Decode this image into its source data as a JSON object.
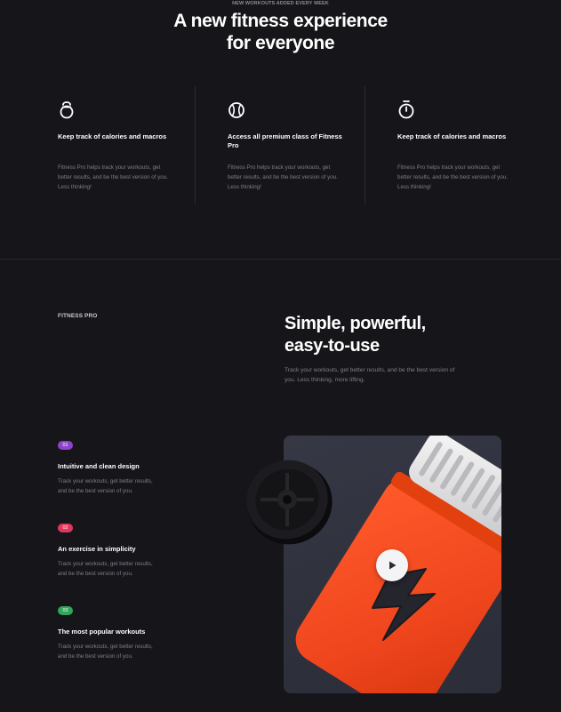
{
  "hero": {
    "eyebrow": "NEW WORKOUTS ADDED EVERY WEEK",
    "title_line1": "A new fitness experience",
    "title_line2": "for everyone"
  },
  "features": [
    {
      "icon": "kettlebell-icon",
      "title": "Keep track of calories and macros",
      "description": "Fitness Pro helps track your workouts, get better results, and be the best version of you. Less thinking!"
    },
    {
      "icon": "ball-icon",
      "title": "Access all premium class of Fitness Pro",
      "description": "Fitness Pro helps track your workouts, get better results, and be the best version of you. Less thinking!"
    },
    {
      "icon": "stopwatch-icon",
      "title": "Keep track of calories and macros",
      "description": "Fitness Pro helps track your workouts, get better results, and be the best version of you. Less thinking!"
    }
  ],
  "section": {
    "brand_label": "FITNESS PRO",
    "title_line1": "Simple, powerful,",
    "title_line2": "easy-to-use",
    "description": "Track your workouts, get better results, and be the best version of you. Less thinking, more lifting."
  },
  "items": [
    {
      "badge": "01",
      "badge_color": "#8e44c9",
      "title": "Intuitive and clean design",
      "description": "Track your workouts, get better results, and be the best version of you."
    },
    {
      "badge": "02",
      "badge_color": "#e0375a",
      "title": "An exercise in simplicity",
      "description": "Track your workouts, get better results, and be the best version of you."
    },
    {
      "badge": "03",
      "badge_color": "#2fa65a",
      "title": "The most popular workouts",
      "description": "Track your workouts, get better results, and be the best version of you."
    }
  ],
  "media": {
    "icon": "play-icon",
    "accent": "#f0461e"
  }
}
